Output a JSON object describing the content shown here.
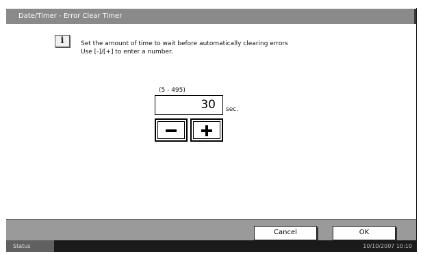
{
  "title": "Date/Timer - Error Clear Timer",
  "info": {
    "icon": "info-icon",
    "line1": "Set the amount of time to wait before automatically clearing errors",
    "line2": "Use [-]/[+] to enter a number."
  },
  "input": {
    "range": "(5 - 495)",
    "value": "30",
    "unit": "sec."
  },
  "buttons": {
    "minus_icon": "minus-icon",
    "plus_icon": "plus-icon",
    "cancel": "Cancel",
    "ok": "OK"
  },
  "status": {
    "label": "Status",
    "datetime": "10/10/2007  10:10"
  }
}
